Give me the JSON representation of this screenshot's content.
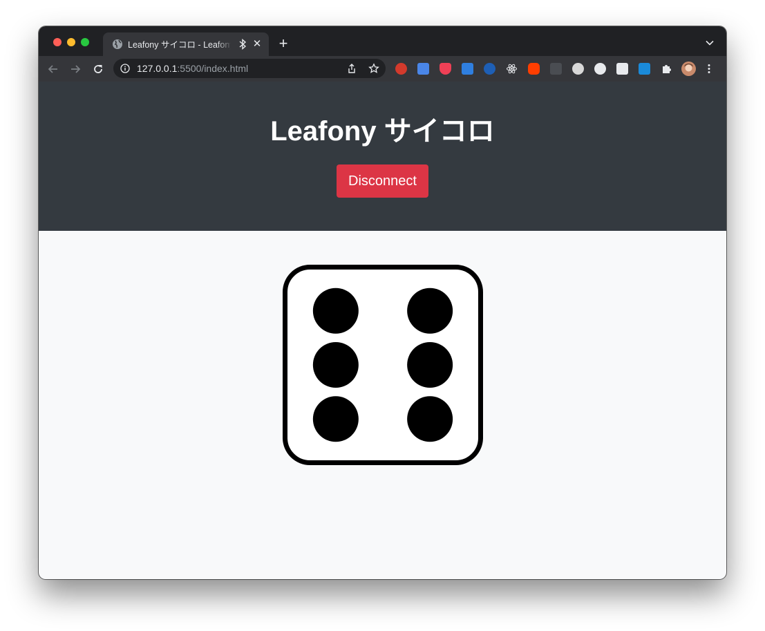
{
  "browser": {
    "tab_title": "Leafony サイコロ - Leafony",
    "url_host": "127.0.0.1",
    "url_rest": ":5500/index.html",
    "extensions": [
      "seo-icon",
      "google-translate-icon",
      "pocket-icon",
      "screenshot-icon",
      "todo-check-icon",
      "react-devtools-icon",
      "svelte-icon",
      "reader-icon",
      "markdown-icon",
      "password-manager-icon",
      "bookmark-icon",
      "translate-badge-icon",
      "extensions-puzzle-icon",
      "profile-avatar",
      "menu-kebab-icon"
    ]
  },
  "page": {
    "title": "Leafony サイコロ",
    "disconnect_label": "Disconnect"
  },
  "die": {
    "value": 6,
    "face_color": "#ffffff",
    "pip_color": "#000000"
  },
  "colors": {
    "header_bg": "#343a40",
    "danger": "#dc3545",
    "page_bg": "#f8f9fa"
  }
}
